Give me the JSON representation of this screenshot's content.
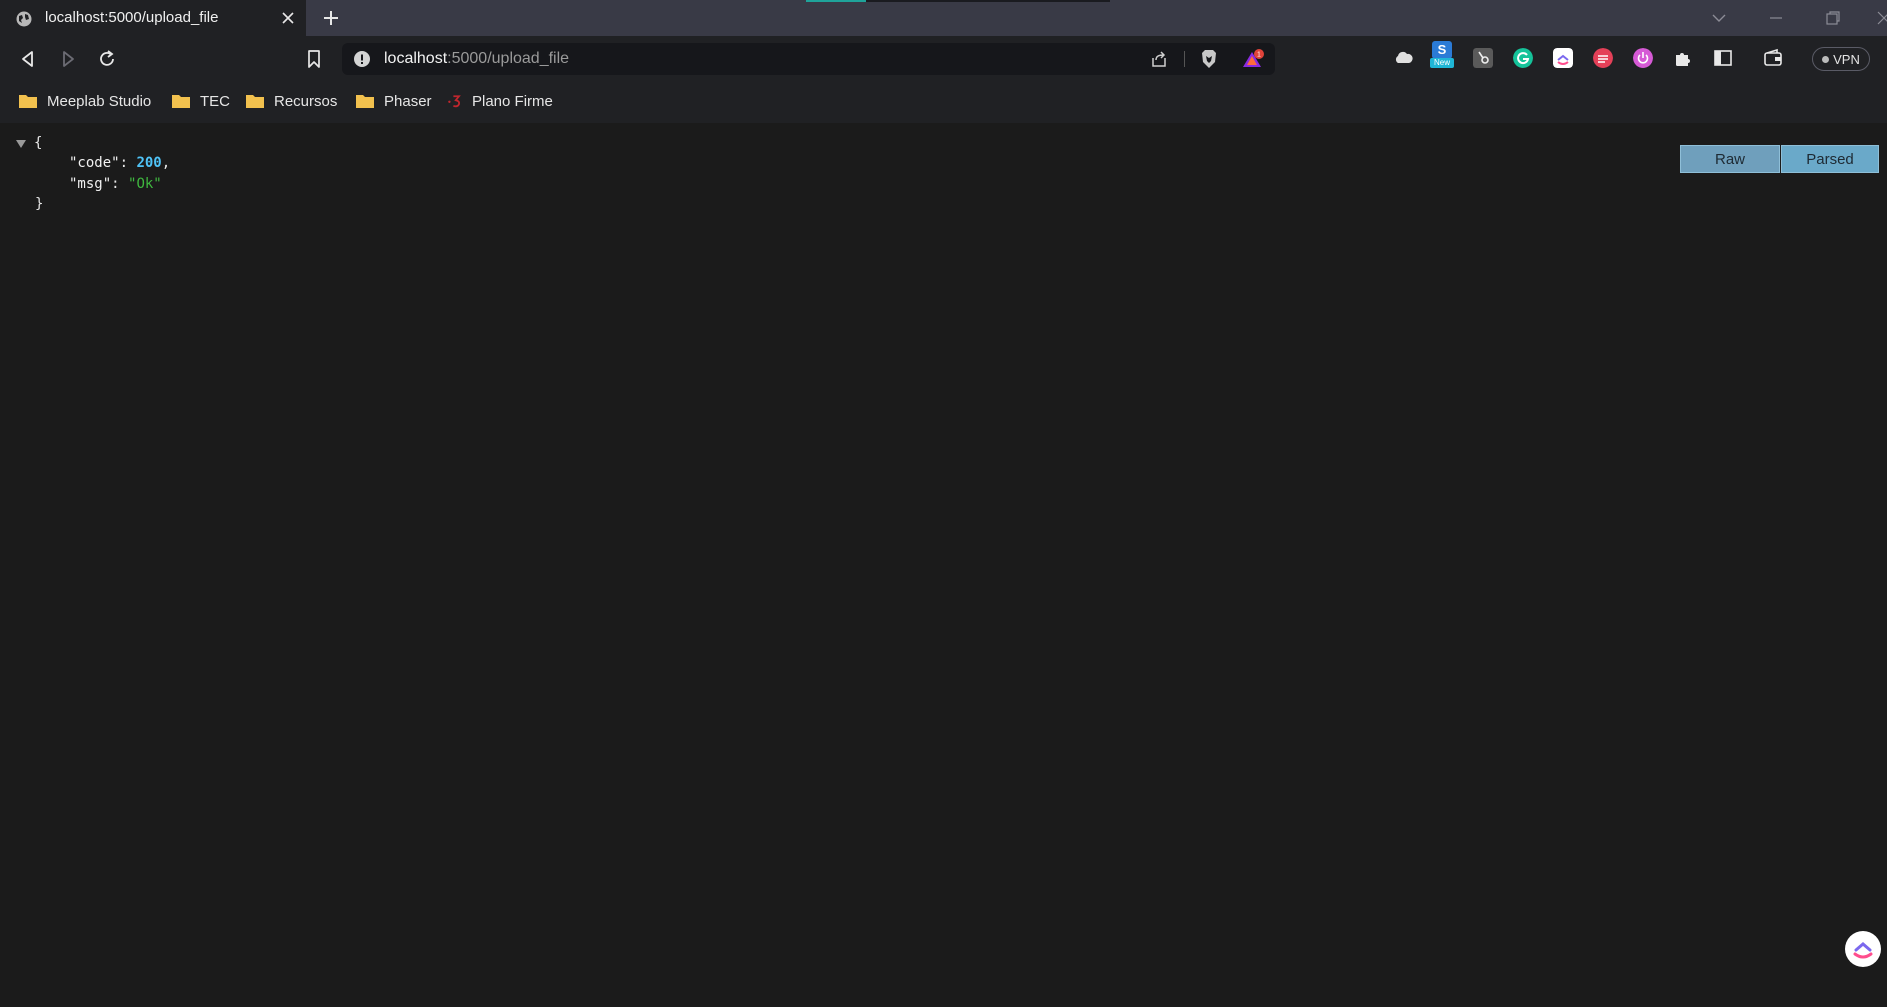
{
  "tab": {
    "title": "localhost:5000/upload_file"
  },
  "omnibox": {
    "host": "localhost",
    "path": ":5000/upload_file",
    "badge_count": "1"
  },
  "extensions": {
    "new_badge": "New"
  },
  "vpn": {
    "label": "VPN"
  },
  "bookmarks": [
    {
      "label": "Meeplab Studio",
      "icon": "folder-icon"
    },
    {
      "label": "TEC",
      "icon": "folder-icon"
    },
    {
      "label": "Recursos",
      "icon": "folder-icon"
    },
    {
      "label": "Phaser",
      "icon": "folder-icon"
    },
    {
      "label": "Plano Firme",
      "icon": "plano-firme-icon"
    }
  ],
  "json_view": {
    "open_brace": "{",
    "close_brace": "}",
    "entries": [
      {
        "key": "\"code\"",
        "value": "200",
        "type": "number",
        "trail": ","
      },
      {
        "key": "\"msg\"",
        "value": "\"Ok\"",
        "type": "string",
        "trail": ""
      }
    ],
    "colon": ": "
  },
  "view_buttons": {
    "raw": "Raw",
    "parsed": "Parsed"
  },
  "colors": {
    "accent": "#6aa9c9",
    "number": "#4fc3f7",
    "string": "#3fb83f",
    "background": "#1b1b1b",
    "chrome": "#202124"
  }
}
